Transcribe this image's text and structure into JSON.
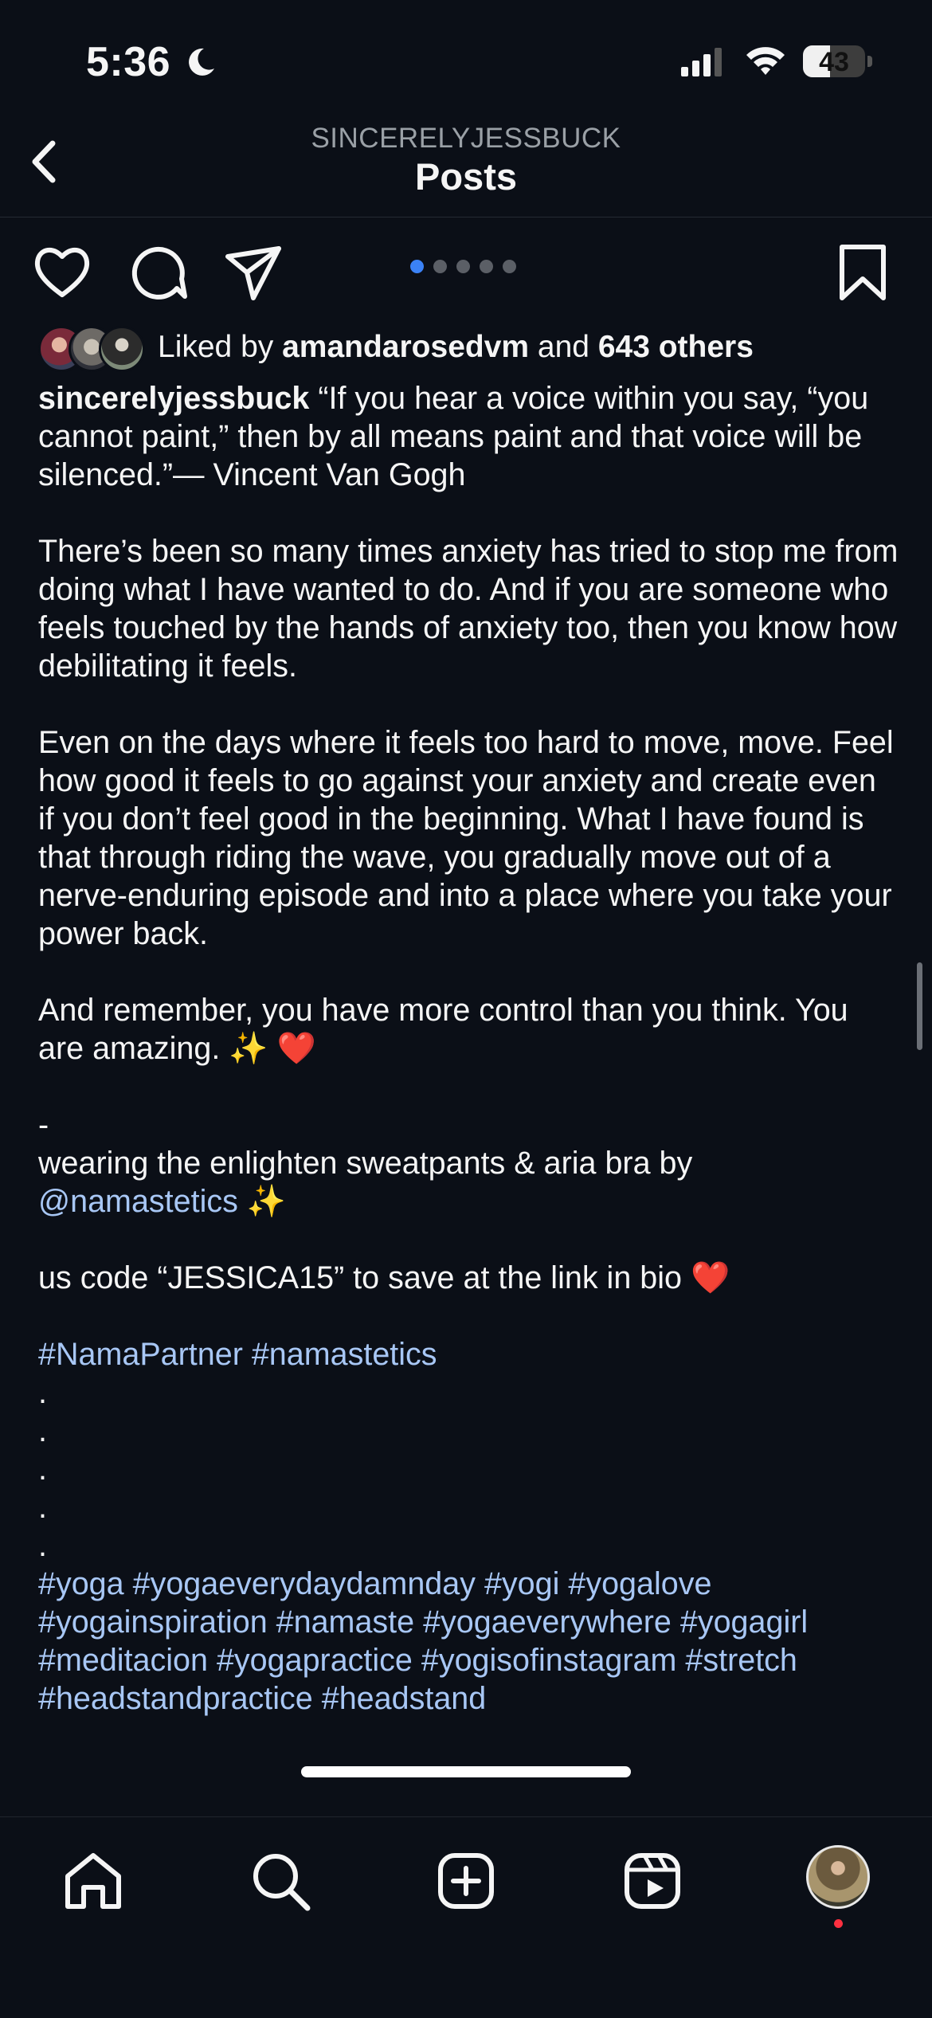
{
  "status_bar": {
    "time": "5:36",
    "battery": "43",
    "battery_level": 0.43
  },
  "header": {
    "subtitle": "SINCERELYJESSBUCK",
    "title": "Posts"
  },
  "carousel": {
    "count": 5,
    "active_index": 0
  },
  "likes": {
    "prefix": "Liked by ",
    "user": "amandarosedvm",
    "middle": " and ",
    "others": "643 others"
  },
  "caption": {
    "username": "sincerelyjessbuck",
    "body1": " “If you hear a voice within you say, “you cannot paint,” then by all means paint and that voice will be silenced.”— Vincent Van Gogh\n\nThere’s been so many times anxiety has tried to stop me from doing what I have wanted to do. And if you are someone who feels touched by the hands of anxiety too, then you know how debilitating it feels.\n\nEven on the days where it feels too hard to move, move. Feel how good it feels to go against your anxiety and create even if you don’t feel good in the beginning. What I have found is that through riding the wave, you gradually move out of a nerve-enduring episode and into a place where you take your power back.\n\nAnd remember, you have more control than you think. You are amazing. ✨ ❤️\n\n-\nwearing the enlighten sweatpants & aria bra by\n",
    "mention": "@namastetics",
    "body2": " ✨\n\nus code “JESSICA15” to save at the link in bio ❤️\n\n",
    "tags1": "#NamaPartner #namastetics",
    "dots": "\n.\n.\n.\n.\n.\n",
    "tags2": "#yoga #yogaeverydaydamnday #yogi #yogalove #yogainspiration #namaste #yogaeverywhere #yogagirl #meditacion #yogapractice #yogisofinstagram #stretch #headstandpractice #headstand"
  },
  "colors": {
    "background": "#0b0f17",
    "link": "#a8c7f5",
    "active_dot": "#3b82f6",
    "notification": "#ff3040"
  }
}
